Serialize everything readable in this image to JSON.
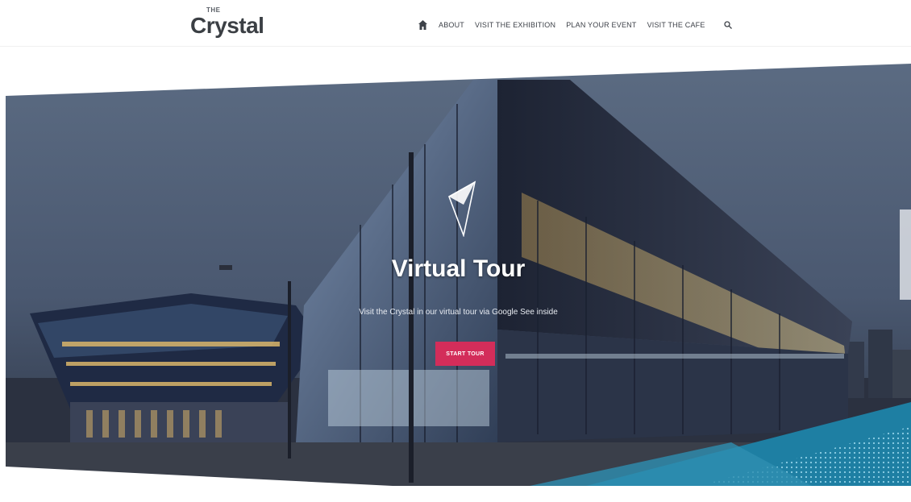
{
  "header": {
    "logo": {
      "small": "THE",
      "big": "Crystal"
    },
    "nav": {
      "items": [
        "ABOUT",
        "VISIT THE EXHIBITION",
        "PLAN YOUR EVENT",
        "VISIT THE CAFE"
      ]
    }
  },
  "hero": {
    "title": "Virtual Tour",
    "subtitle": "Visit the Crystal in our virtual tour via Google See inside",
    "button_label": "START TOUR"
  },
  "colors": {
    "accent": "#d32d5a",
    "sky": "#4a5a70",
    "teal": "#2e8fb0"
  },
  "icons": [
    "home-icon",
    "search-icon",
    "triangle-logo-icon"
  ]
}
